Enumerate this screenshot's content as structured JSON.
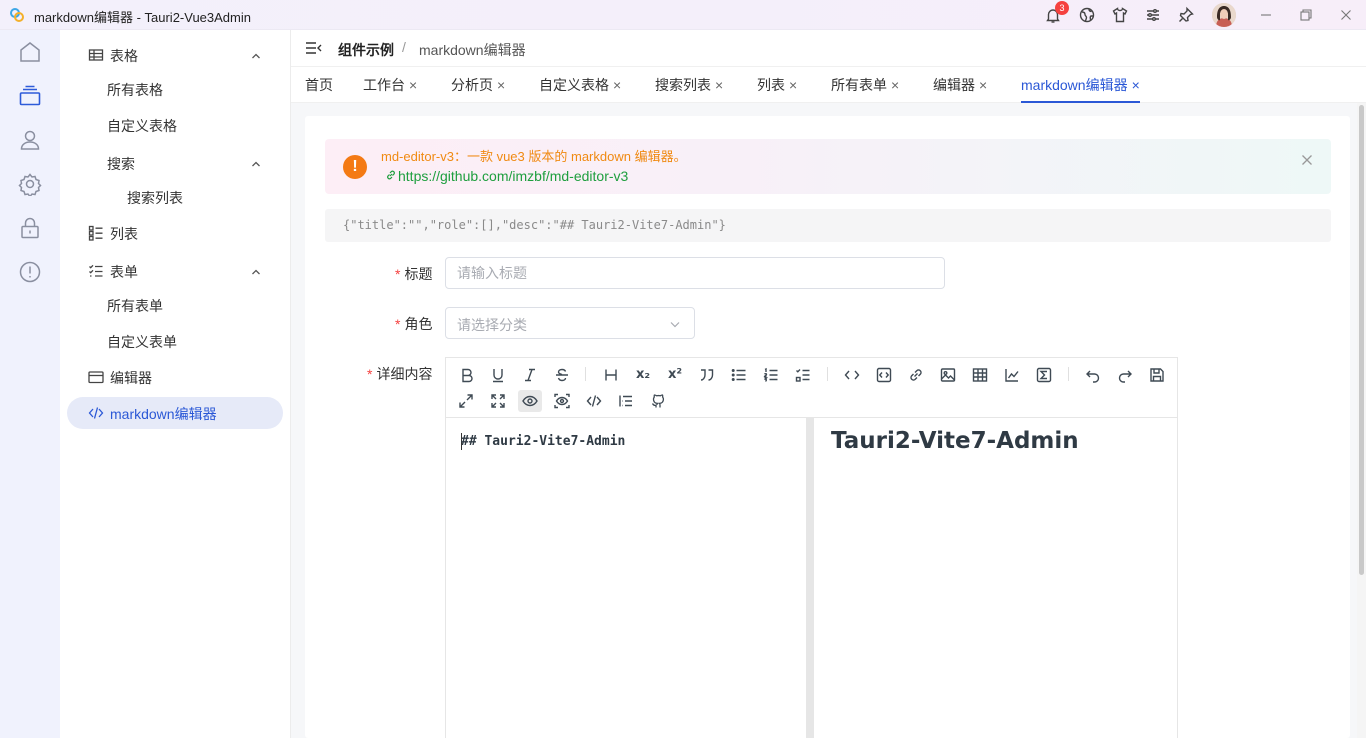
{
  "window": {
    "title": "markdown编辑器 - Tauri2-Vue3Admin",
    "notification_count": "3",
    "icons": [
      "bell-icon",
      "globe-icon",
      "shirt-icon",
      "sliders-icon",
      "pin-icon",
      "avatar",
      "minimize-icon",
      "restore-icon",
      "close-icon"
    ]
  },
  "rail": {
    "items": [
      "home-icon",
      "components-icon",
      "user-icon",
      "settings-icon",
      "lock-icon",
      "alert-icon"
    ],
    "active": "components-icon"
  },
  "menu": {
    "items": [
      {
        "label": "表格",
        "icon": "table-icon",
        "expanded": true
      },
      {
        "label": "所有表格"
      },
      {
        "label": "自定义表格"
      },
      {
        "label": "搜索",
        "expanded": true
      },
      {
        "label": "搜索列表"
      },
      {
        "label": "列表",
        "icon": "list-icon"
      },
      {
        "label": "表单",
        "icon": "form-icon",
        "expanded": true
      },
      {
        "label": "所有表单"
      },
      {
        "label": "自定义表单"
      },
      {
        "label": "编辑器",
        "icon": "editor-icon"
      },
      {
        "label": "markdown编辑器",
        "icon": "code-icon",
        "active": true
      }
    ]
  },
  "breadcrumb": {
    "parent": "组件示例",
    "separator": "/",
    "current": "markdown编辑器"
  },
  "tabs": [
    {
      "label": "首页",
      "closable": false
    },
    {
      "label": "工作台",
      "closable": true
    },
    {
      "label": "分析页",
      "closable": true
    },
    {
      "label": "自定义表格",
      "closable": true
    },
    {
      "label": "搜索列表",
      "closable": true
    },
    {
      "label": "列表",
      "closable": true
    },
    {
      "label": "所有表单",
      "closable": true
    },
    {
      "label": "编辑器",
      "closable": true
    },
    {
      "label": "markdown编辑器",
      "closable": true,
      "active": true
    }
  ],
  "tab_close_glyph": "×",
  "alert": {
    "title": "md-editor-v3：一款 vue3 版本的 markdown 编辑器。",
    "link": "https://github.com/imzbf/md-editor-v3",
    "icon": "!"
  },
  "json_preview": "{\"title\":\"\",\"role\":[],\"desc\":\"## Tauri2-Vite7-Admin\"}",
  "form": {
    "title_label": "标题",
    "title_placeholder": "请输入标题",
    "role_label": "角色",
    "role_placeholder": "请选择分类",
    "content_label": "详细内容",
    "required_mark": "*"
  },
  "editor": {
    "source": "## Tauri2-Vite7-Admin",
    "preview_heading": "Tauri2-Vite7-Admin",
    "toolbar": [
      "bold",
      "underline",
      "italic",
      "strikethrough",
      "title",
      "sub",
      "sup",
      "quote",
      "unordered-list",
      "ordered-list",
      "task",
      "code-row",
      "code",
      "link",
      "image",
      "table",
      "mermaid",
      "katex",
      "revoke",
      "next",
      "save",
      "page-fullscreen",
      "fullscreen",
      "preview",
      "preview-only",
      "html-preview",
      "catalog",
      "github"
    ],
    "active_tool": "preview",
    "sub_label": "x₂",
    "sup_label": "x²"
  },
  "colors": {
    "accent": "#2b58d6",
    "alert_title": "#f08a12",
    "alert_link": "#1e9e3e",
    "required": "#f5413f"
  }
}
